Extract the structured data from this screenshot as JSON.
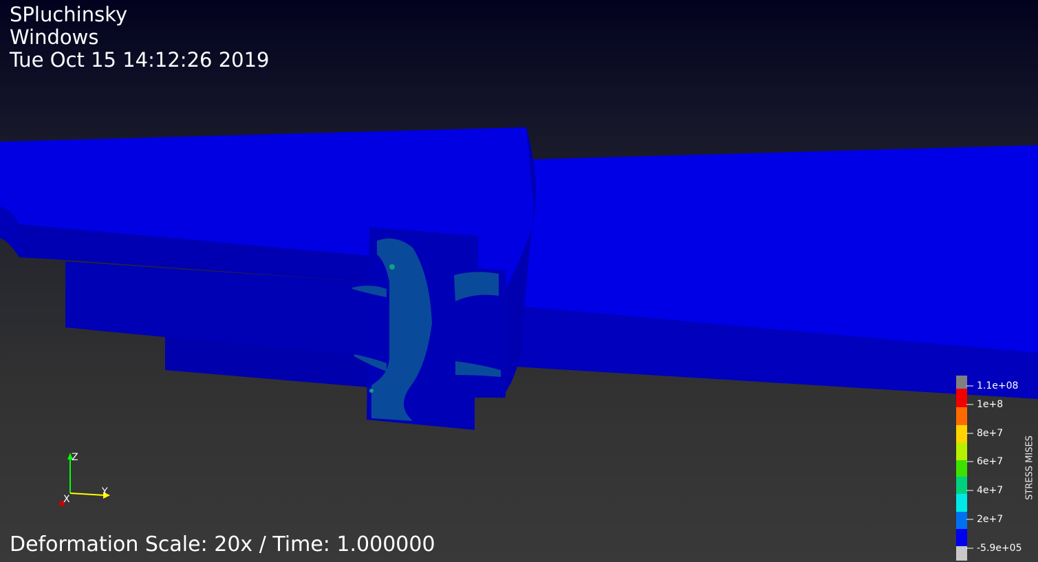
{
  "header": {
    "user": "SPluchinsky",
    "os": "Windows",
    "timestamp": "Tue Oct 15 14:12:26 2019"
  },
  "footer": {
    "caption": "Deformation Scale: 20x / Time: 1.000000"
  },
  "legend": {
    "title": "STRESS MISES",
    "ticks": [
      "1.1e+08",
      "1e+8",
      "8e+7",
      "6e+7",
      "4e+7",
      "2e+7",
      "-5.9e+05"
    ],
    "colors": [
      "#808080",
      "#f00000",
      "#ff6a00",
      "#ffd400",
      "#b7f000",
      "#3ee000",
      "#00d080",
      "#00e8e8",
      "#0070f0",
      "#0000ee",
      "#c8c8c8"
    ]
  },
  "axes": {
    "z": "Z",
    "y": "Y",
    "x": "X",
    "colors": {
      "z": "#00ff00",
      "y": "#ffff00",
      "x": "#ff0000"
    }
  },
  "colors": {
    "background_top": "#02021f",
    "background_bottom": "#393939",
    "model_bright": "#0000e6",
    "model_mid": "#0000c4",
    "model_dark": "#0000a8",
    "stress_low": "#0a4a9a"
  }
}
